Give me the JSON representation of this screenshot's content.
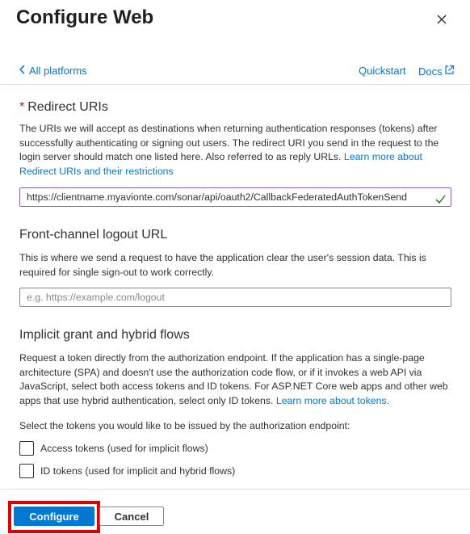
{
  "panel": {
    "title": "Configure Web"
  },
  "nav": {
    "back_label": "All platforms",
    "quickstart_label": "Quickstart",
    "docs_label": "Docs"
  },
  "redirect": {
    "required_marker": "*",
    "title": "Redirect URIs",
    "description": "The URIs we will accept as destinations when returning authentication responses (tokens) after successfully authenticating or signing out users. The redirect URI you send in the request to the login server should match one listed here. Also referred to as reply URLs.",
    "link_text": "Learn more about Redirect URIs and their restrictions",
    "uri_value": "https://clientname.myavionte.com/sonar/api/oauth2/CallbackFederatedAuthTokenSend"
  },
  "logout": {
    "title": "Front-channel logout URL",
    "description": "This is where we send a request to have the application clear the user's session data. This is required for single sign-out to work correctly.",
    "placeholder": "e.g. https://example.com/logout"
  },
  "implicit": {
    "title": "Implicit grant and hybrid flows",
    "description": "Request a token directly from the authorization endpoint. If the application has a single-page architecture (SPA) and doesn't use the authorization code flow, or if it invokes a web API via JavaScript, select both access tokens and ID tokens. For ASP.NET Core web apps and other web apps that use hybrid authentication, select only ID tokens.",
    "link_text": "Learn more about tokens.",
    "select_prompt": "Select the tokens you would like to be issued by the authorization endpoint:",
    "options": [
      {
        "label": "Access tokens (used for implicit flows)",
        "checked": false
      },
      {
        "label": "ID tokens (used for implicit and hybrid flows)",
        "checked": false
      }
    ]
  },
  "footer": {
    "configure_label": "Configure",
    "cancel_label": "Cancel"
  },
  "colors": {
    "accent": "#0078d4",
    "required": "#a4262c",
    "highlight": "#e00000",
    "valid_check": "#107c10"
  },
  "icons": {
    "close": "close-icon",
    "back": "chevron-left-icon",
    "external": "external-link-icon",
    "valid": "checkmark-icon"
  }
}
